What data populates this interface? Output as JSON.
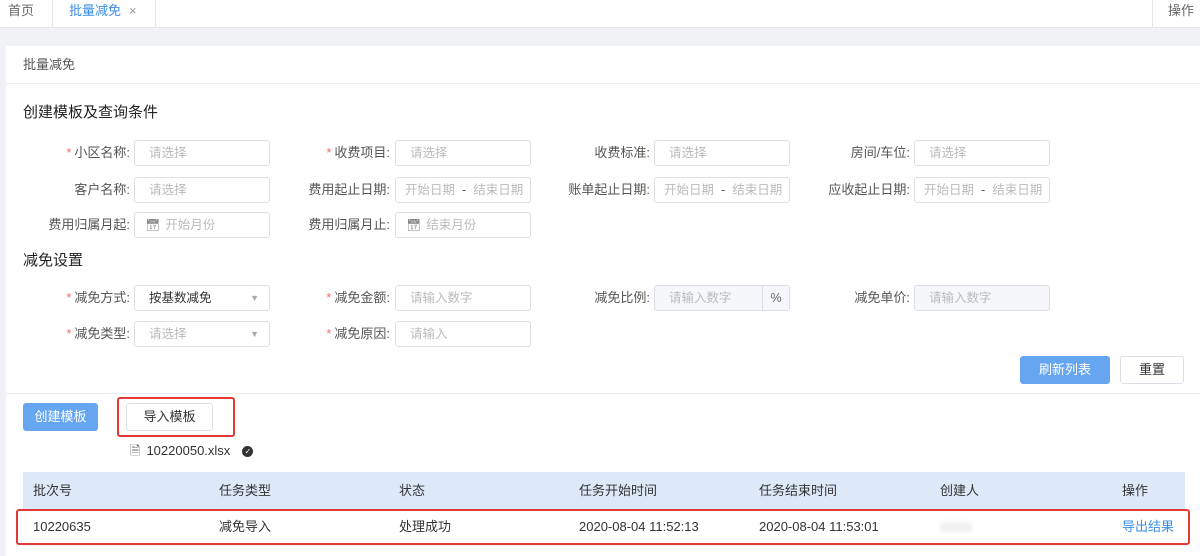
{
  "tabs": {
    "home": "首页",
    "active": "批量减免",
    "close": "×",
    "ops": "操作"
  },
  "card": {
    "header": "批量减免"
  },
  "query": {
    "title": "创建模板及查询条件",
    "community": {
      "label": "小区名称:",
      "placeholder": "请选择"
    },
    "charge_item": {
      "label": "收费项目:",
      "placeholder": "请选择"
    },
    "charge_std": {
      "label": "收费标准:",
      "placeholder": "请选择"
    },
    "room": {
      "label": "房间/车位:",
      "placeholder": "请选择"
    },
    "customer": {
      "label": "客户名称:",
      "placeholder": "请选择"
    },
    "fee_range": {
      "label": "费用起止日期:",
      "start": "开始日期",
      "sep": "-",
      "end": "结束日期"
    },
    "bill_range": {
      "label": "账单起止日期:",
      "start": "开始日期",
      "sep": "-",
      "end": "结束日期"
    },
    "due_range": {
      "label": "应收起止日期:",
      "start": "开始日期",
      "sep": "-",
      "end": "结束日期"
    },
    "month_start": {
      "label": "费用归属月起:",
      "placeholder": "开始月份"
    },
    "month_end": {
      "label": "费用归属月止:",
      "placeholder": "结束月份"
    }
  },
  "relief": {
    "title": "减免设置",
    "method": {
      "label": "减免方式:",
      "value": "按基数减免"
    },
    "amount": {
      "label": "减免金额:",
      "placeholder": "请输入数字"
    },
    "ratio": {
      "label": "减免比例:",
      "placeholder": "请输入数字",
      "unit": "%"
    },
    "unit_price": {
      "label": "减免单价:",
      "placeholder": "请输入数字"
    },
    "type": {
      "label": "减免类型:",
      "placeholder": "请选择"
    },
    "reason": {
      "label": "减免原因:",
      "placeholder": "请输入"
    }
  },
  "buttons": {
    "refresh": "刷新列表",
    "reset": "重置",
    "create_template": "创建模板",
    "import_template": "导入模板"
  },
  "file": {
    "name": "10220050.xlsx"
  },
  "table": {
    "columns": [
      "批次号",
      "任务类型",
      "状态",
      "任务开始时间",
      "任务结束时间",
      "创建人",
      "操作"
    ],
    "rows": [
      {
        "batch": "10220635",
        "task_type": "减免导入",
        "status": "处理成功",
        "start": "2020-08-04 11:52:13",
        "end": "2020-08-04 11:53:01",
        "creator": "",
        "action": "导出结果"
      }
    ]
  },
  "colors": {
    "primary": "#66a6f0",
    "link": "#3a8ee6",
    "required": "#f56c6c",
    "highlight": "#e53935",
    "table_header": "#dde9f8"
  },
  "icons": {
    "file": "file-icon",
    "success": "check-circle-icon",
    "calendar": "calendar-icon",
    "dropdown": "chevron-down-icon"
  }
}
